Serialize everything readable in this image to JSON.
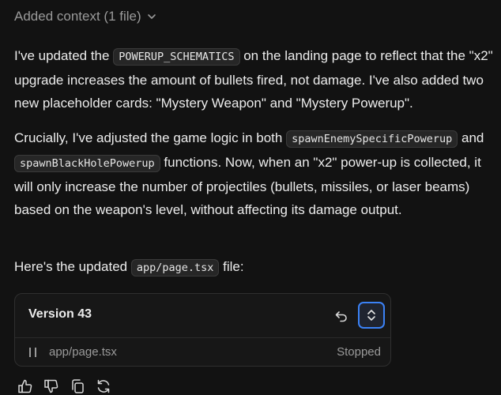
{
  "context": {
    "label": "Added context (1 file)",
    "icon": "chevron-down-icon"
  },
  "message": {
    "p1": {
      "t1": "I've updated the ",
      "code1": "POWERUP_SCHEMATICS",
      "t2": " on the landing page to reflect that the \"x2\" upgrade increases the amount of bullets fired, not damage. I've also added two new placeholder cards: \"Mystery Weapon\" and \"Mystery Powerup\"."
    },
    "p2": {
      "t1": "Crucially, I've adjusted the game logic in both ",
      "code1": "spawnEnemySpecificPowerup",
      "t2": " and ",
      "code2": "spawnBlackHolePowerup",
      "t3": " functions. Now, when an \"x2\" power-up is collected, it will only increase the number of projectiles (bullets, missiles, or laser beams) based on the weapon's level, without affecting its damage output."
    },
    "p3": {
      "t1": "Here's the updated ",
      "code1": "app/page.tsx",
      "t2": " file:"
    }
  },
  "version_card": {
    "title": "Version 43",
    "file": "app/page.tsx",
    "status": "Stopped",
    "accent": "#3b82f6"
  },
  "actions": [
    "thumbs-up-icon",
    "thumbs-down-icon",
    "copy-icon",
    "regenerate-icon"
  ]
}
